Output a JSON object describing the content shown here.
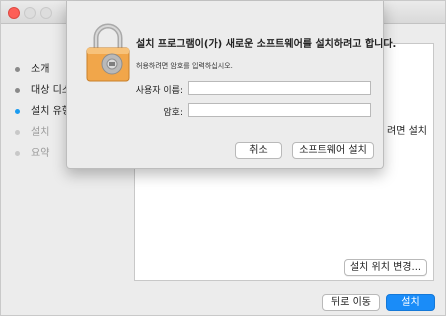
{
  "window": {
    "traffic_lights": [
      "close",
      "minimize",
      "zoom"
    ]
  },
  "sidebar": {
    "steps": [
      {
        "label": "소개",
        "state": "done"
      },
      {
        "label": "대상 디스",
        "state": "done"
      },
      {
        "label": "설치 유형",
        "state": "active"
      },
      {
        "label": "설치",
        "state": "pending"
      },
      {
        "label": "요약",
        "state": "pending"
      }
    ]
  },
  "main": {
    "partial_text": "려면 설치",
    "change_location_label": "설치 위치 변경..."
  },
  "footer": {
    "back_label": "뒤로 이동",
    "install_label": "설치"
  },
  "auth_sheet": {
    "title": "설치 프로그램이(가) 새로운 소프트웨어를 설치하려고 합니다.",
    "subtitle": "허용하려면 암호를 입력하십시오.",
    "username_label": "사용자 이름:",
    "username_value": "",
    "password_label": "암호:",
    "password_value": "",
    "cancel_label": "취소",
    "install_software_label": "소프트웨어 설치",
    "icon": "lock-icon"
  },
  "colors": {
    "accent": "#1a8cf8",
    "close_light": "#fd5f57",
    "active_step": "#1b9bf0",
    "lock_body": "#f1a64a"
  }
}
